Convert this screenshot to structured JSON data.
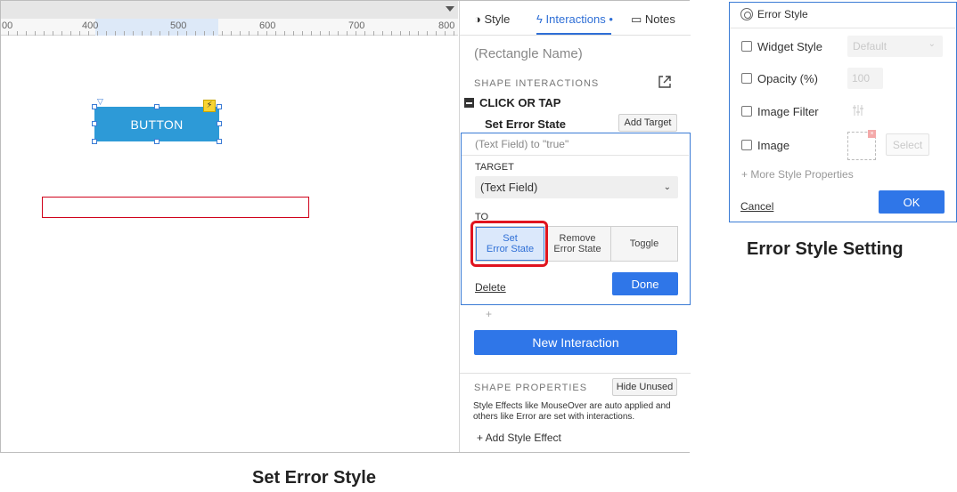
{
  "ruler": {
    "labels": [
      "00",
      "400",
      "500",
      "600",
      "700",
      "800"
    ]
  },
  "canvas": {
    "button_label": "BUTTON",
    "bolt_glyph": "⚡",
    "marker_glyph": "▽"
  },
  "panel": {
    "tabs": {
      "style": "Style",
      "interactions": "Interactions",
      "interactions_dot": "•",
      "notes": "Notes"
    },
    "shape_name": "(Rectangle Name)",
    "shape_interactions_header": "SHAPE INTERACTIONS",
    "event_label": "CLICK OR TAP",
    "action_label": "Set Error State",
    "add_target": "Add Target",
    "card": {
      "summary": "(Text Field) to \"true\"",
      "target_label": "TARGET",
      "target_value": "(Text Field)",
      "to_label": "TO",
      "options": {
        "set_line1": "Set",
        "set_line2": "Error State",
        "remove_line1": "Remove",
        "remove_line2": "Error State",
        "toggle": "Toggle"
      },
      "delete": "Delete",
      "done": "Done"
    },
    "plus": "+",
    "new_interaction": "New Interaction",
    "shape_properties_header": "SHAPE PROPERTIES",
    "hide_unused": "Hide Unused",
    "properties_description": "Style Effects like MouseOver are auto applied and others like Error are set with interactions.",
    "add_style_effect": "+ Add Style Effect"
  },
  "error_style": {
    "title": "Error Style",
    "widget_style": "Widget Style",
    "widget_style_value": "Default",
    "opacity": "Opacity (%)",
    "opacity_value": "100",
    "image_filter": "Image Filter",
    "image": "Image",
    "select": "Select",
    "more_props": "+ More Style Properties",
    "cancel": "Cancel",
    "ok": "OK"
  },
  "captions": {
    "left": "Set Error Style",
    "right": "Error Style Setting"
  },
  "colors": {
    "accent": "#2f76e8",
    "button_fill": "#2d9ad7",
    "highlight": "#e0141e",
    "error_border": "#d0021b"
  }
}
